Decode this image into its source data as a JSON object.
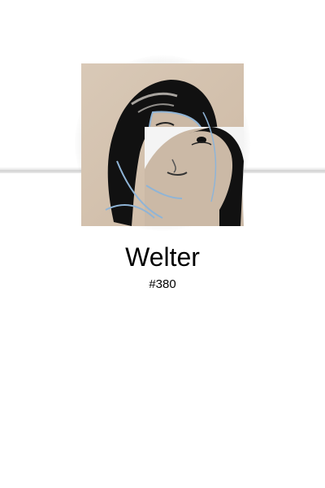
{
  "profile": {
    "name": "Welter",
    "number": "#380",
    "avatar_icon": "sketch-portrait-icon"
  },
  "colors": {
    "background": "#ffffff",
    "text": "#000000",
    "paper": "#d8c8b6"
  }
}
